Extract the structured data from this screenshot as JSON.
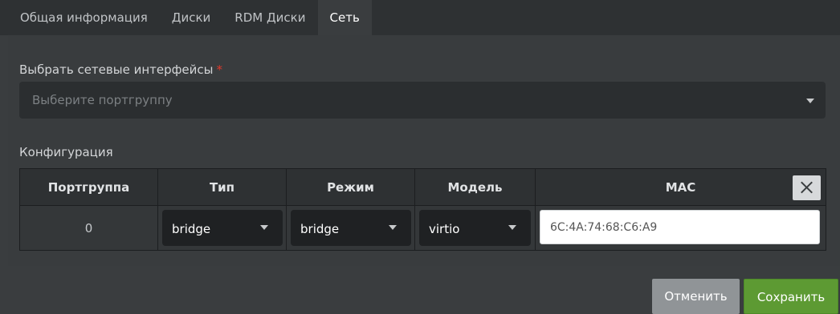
{
  "tabs": [
    {
      "label": "Общая информация"
    },
    {
      "label": "Диски"
    },
    {
      "label": "RDM Диски"
    },
    {
      "label": "Сеть",
      "active": true
    }
  ],
  "network": {
    "select_label": "Выбрать сетевые интерфейсы",
    "required_mark": "*",
    "select_placeholder": "Выберите портгруппу"
  },
  "config": {
    "label": "Конфигурация",
    "columns": [
      "Портгруппа",
      "Тип",
      "Режим",
      "Модель",
      "MAC"
    ],
    "row": {
      "portgroup": "0",
      "type": "bridge",
      "mode": "bridge",
      "model": "virtio",
      "mac": "6C:4A:74:68:C6:A9"
    }
  },
  "footer": {
    "cancel_label": "Отменить",
    "save_label": "Сохранить"
  },
  "colors": {
    "save": "#5d9a33",
    "cancel": "#909497",
    "required": "#e0392b"
  }
}
